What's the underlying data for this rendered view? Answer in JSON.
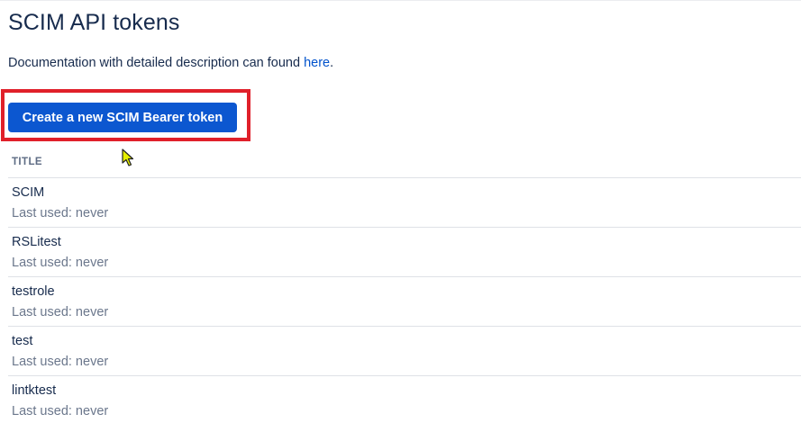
{
  "page": {
    "title": "SCIM API tokens",
    "doc_text": "Documentation with detailed description can found ",
    "doc_link": "here",
    "doc_suffix": "."
  },
  "actions": {
    "create_label": "Create a new SCIM Bearer token"
  },
  "table": {
    "column_title": "TITLE",
    "rows": [
      {
        "title": "SCIM",
        "last_used": "Last used: never"
      },
      {
        "title": "RSLitest",
        "last_used": "Last used: never"
      },
      {
        "title": "testrole",
        "last_used": "Last used: never"
      },
      {
        "title": "test",
        "last_used": "Last used: never"
      },
      {
        "title": "lintktest",
        "last_used": "Last used: never"
      }
    ]
  },
  "colors": {
    "accent": "#0c57d0",
    "link": "#0052cc",
    "highlight": "#e0202a"
  },
  "icons": {
    "cursor": "mouse-pointer-icon"
  }
}
